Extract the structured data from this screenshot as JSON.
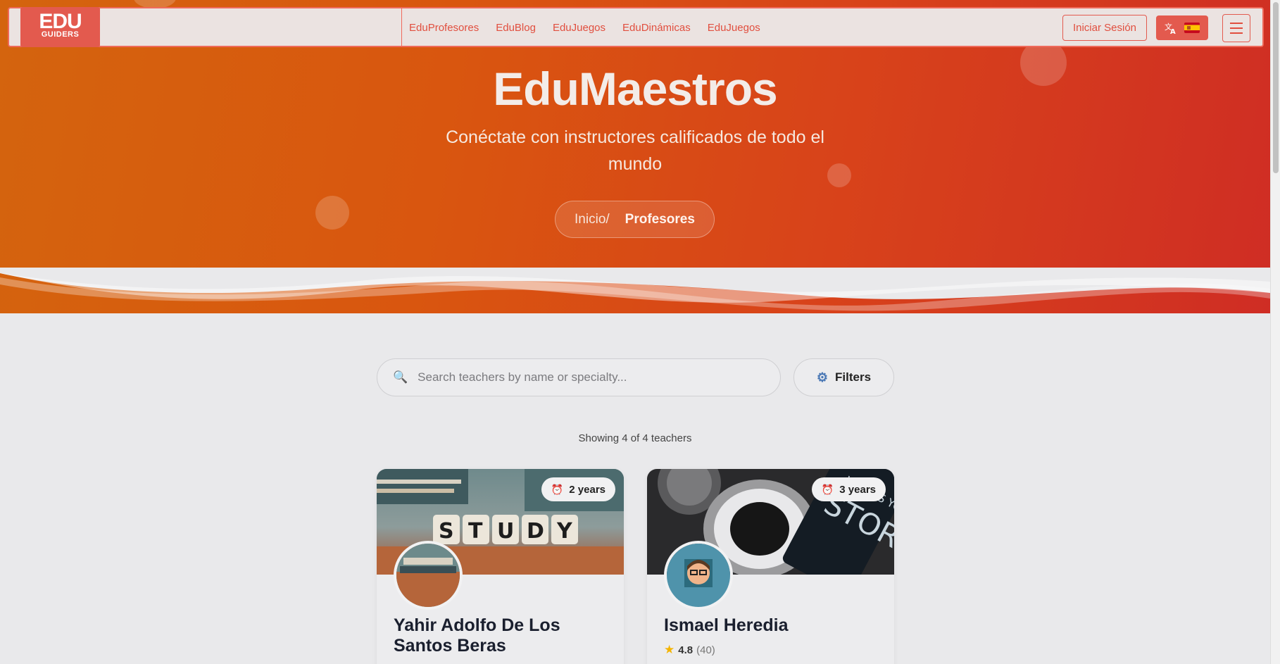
{
  "nav": {
    "logo_top": "EDU",
    "logo_bottom": "GUIDERS",
    "links": [
      "EduProfesores",
      "EduBlog",
      "EduJuegos",
      "EduDinámicas",
      "EduJuegos"
    ],
    "login_label": "Iniciar Sesión",
    "lang_icon": "translate-icon",
    "lang_flag": "spain-flag",
    "menu_icon": "hamburger-icon",
    "accent_color": "#e35a4e"
  },
  "hero": {
    "title": "EduMaestros",
    "subtitle": "Conéctate con instructores calificados de todo el mundo",
    "breadcrumb_home": "Inicio/",
    "breadcrumb_current": "Profesores"
  },
  "search": {
    "placeholder": "Search teachers by name or specialty...",
    "value": "",
    "filters_label": "Filters",
    "search_icon": "search-icon",
    "filters_icon": "gear-icon"
  },
  "results": {
    "showing_text": "Showing 4 of 4 teachers"
  },
  "teachers": [
    {
      "name": "Yahir Adolfo De Los Santos Beras",
      "experience": "2 years"
    },
    {
      "name": "Ismael Heredia",
      "experience": "3 years",
      "rating": "4.8",
      "reviews": "(40)"
    }
  ]
}
